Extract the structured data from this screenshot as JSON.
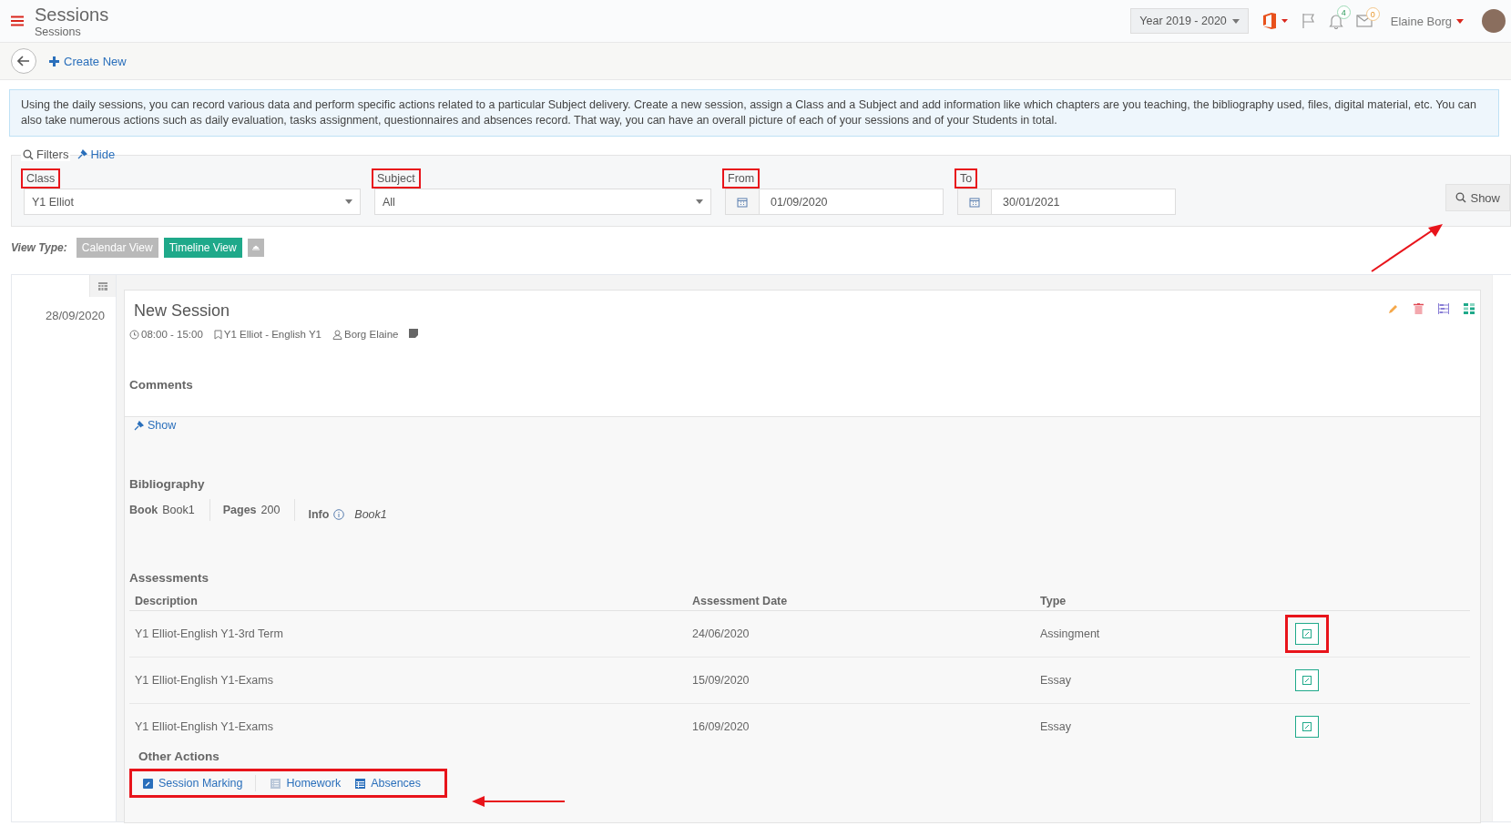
{
  "header": {
    "title": "Sessions",
    "subtitle": "Sessions",
    "year_selector": "Year 2019 - 2020",
    "notifications_count": "4",
    "messages_count": "0",
    "user_name": "Elaine Borg"
  },
  "toolbar": {
    "create_button": "Create New"
  },
  "info_text": "Using the daily sessions, you can record various data and perform specific actions related to a particular Subject delivery. Create a new session, assign a Class and a Subject and add information like which chapters are you teaching, the bibliography used, files, digital material, etc. You can also take numerous actions such as daily evaluation, tasks assignment, questionnaires and absences record. That way, you can have an overall picture of each of your sessions and of your Students in total.",
  "filters": {
    "title": "Filters",
    "toggle": "Hide",
    "show_button": "Show",
    "fields": [
      {
        "kind": "select",
        "label": "Class",
        "value": "Y1 Elliot",
        "highlighted": true
      },
      {
        "kind": "select",
        "label": "Subject",
        "value": "All",
        "highlighted": true
      },
      {
        "kind": "date",
        "label": "From",
        "value": "01/09/2020",
        "highlighted": true
      },
      {
        "kind": "date",
        "label": "To",
        "value": "30/01/2021",
        "highlighted": true
      }
    ]
  },
  "view_type": {
    "label": "View Type:",
    "options": [
      {
        "label": "Calendar View",
        "selected": false
      },
      {
        "label": "Timeline View",
        "selected": true
      }
    ]
  },
  "session": {
    "date": "28/09/2020",
    "title": "New Session",
    "time": "08:00 - 15:00",
    "class_subject": "Y1 Elliot - English Y1",
    "teacher": "Borg Elaine",
    "comments": {
      "heading": "Comments",
      "toggle": "Show"
    },
    "bibliography": {
      "heading": "Bibliography",
      "fields": [
        {
          "kind": "plain",
          "label": "Book",
          "value": "Book1"
        },
        {
          "kind": "plain",
          "label": "Pages",
          "value": "200"
        },
        {
          "kind": "info",
          "label": "Info",
          "value": "Book1"
        }
      ]
    },
    "assessments": {
      "heading": "Assessments",
      "columns": [
        "Description",
        "Assessment Date",
        "Type"
      ],
      "rows": [
        {
          "cells": [
            "Y1 Elliot-English Y1-3rd Term",
            "24/06/2020",
            "Assingment"
          ],
          "highlighted": true
        },
        {
          "cells": [
            "Y1 Elliot-English Y1-Exams",
            "15/09/2020",
            "Essay"
          ],
          "highlighted": false
        },
        {
          "cells": [
            "Y1 Elliot-English Y1-Exams",
            "16/09/2020",
            "Essay"
          ],
          "highlighted": false
        }
      ]
    },
    "other_actions": {
      "heading": "Other Actions",
      "highlighted": true,
      "actions": [
        {
          "kind": "marking",
          "label": "Session Marking"
        },
        {
          "kind": "list",
          "label": "Homework"
        },
        {
          "kind": "table",
          "label": "Absences"
        }
      ]
    }
  }
}
